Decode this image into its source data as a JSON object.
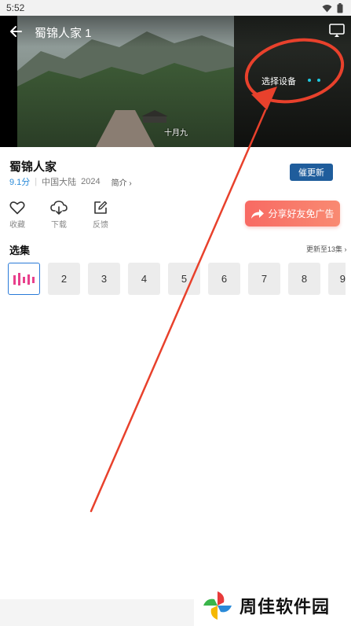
{
  "status_bar": {
    "time": "5:52"
  },
  "player": {
    "title": "蜀锦人家 1",
    "subtitle": "十月九",
    "device_select": "选择设备"
  },
  "drama": {
    "title": "蜀锦人家",
    "score": "9.1分",
    "region": "中国大陆",
    "year": "2024",
    "intro_label": "简介 ›",
    "urge_label": "催更新"
  },
  "actions": [
    {
      "name": "collect",
      "label": "收藏",
      "icon": "heart-icon"
    },
    {
      "name": "download",
      "label": "下载",
      "icon": "cloud-download-icon"
    },
    {
      "name": "feedback",
      "label": "反馈",
      "icon": "edit-icon"
    }
  ],
  "share": {
    "label": "分享好友免广告"
  },
  "episodes": {
    "title": "选集",
    "update_info": "更新至13集 ›",
    "items": [
      "",
      "2",
      "3",
      "4",
      "5",
      "6",
      "7",
      "8",
      "9"
    ]
  },
  "watermark": {
    "text": "周佳软件园"
  },
  "colors": {
    "accent_blue": "#1f5d9c",
    "share_red": "#f86a63",
    "annotation_red": "#e8412c",
    "playing_pink": "#e8408c"
  }
}
